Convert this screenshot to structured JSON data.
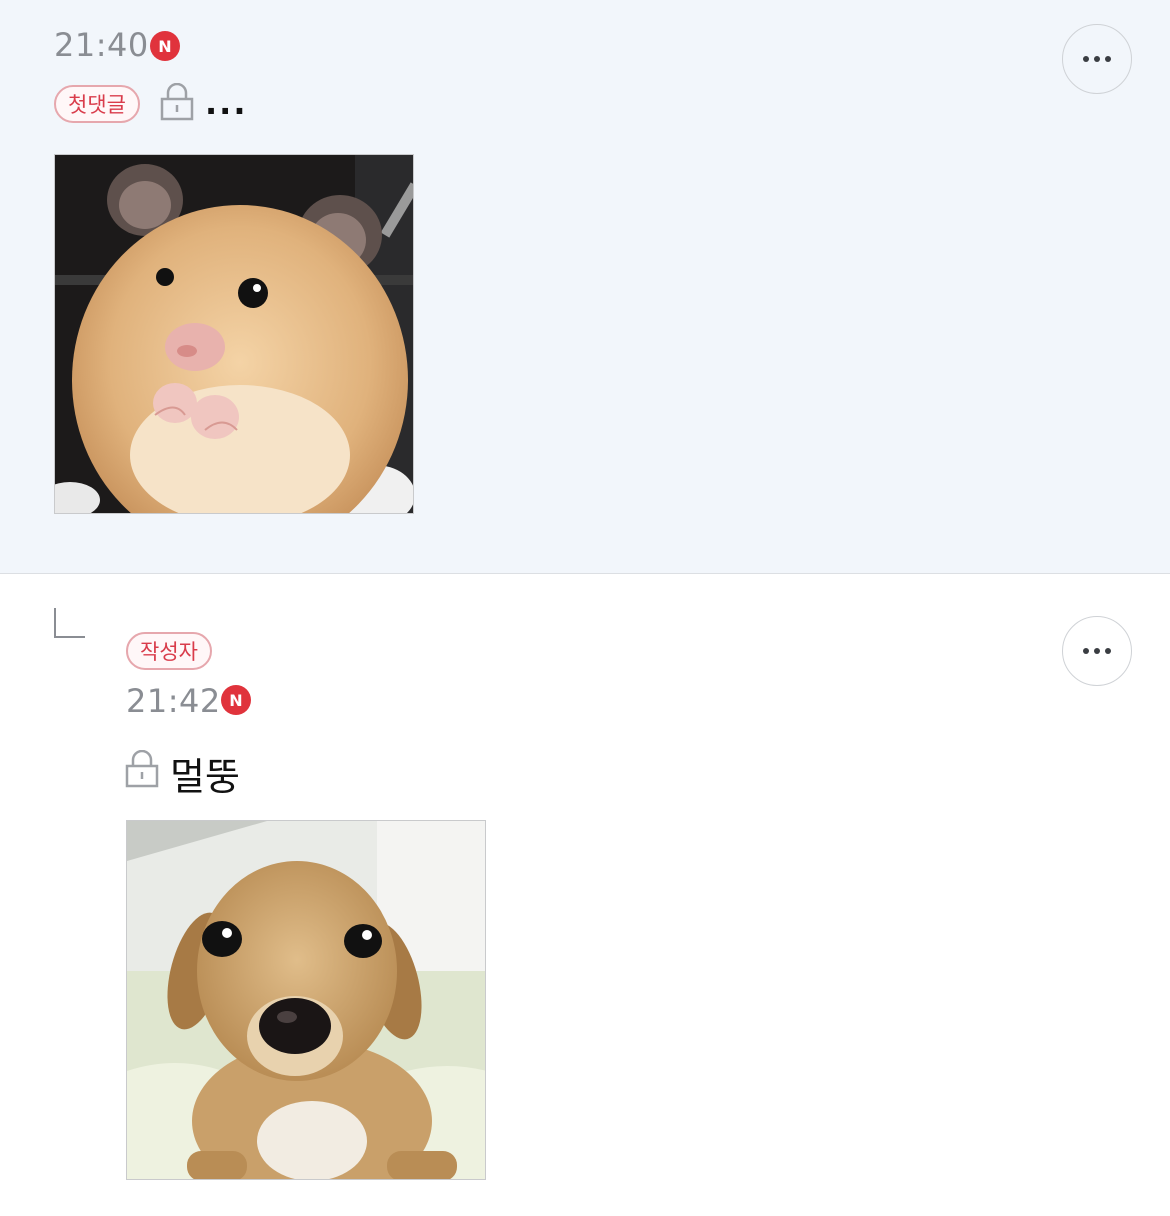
{
  "comment_1": {
    "time": "21:40",
    "new_badge": "N",
    "badge_label": "첫댓글",
    "text": "...",
    "image_subject": "hamster",
    "lock_icon": "lock-icon",
    "more_icon": "more-horizontal-icon"
  },
  "comment_2": {
    "author_badge": "작성자",
    "time": "21:42",
    "new_badge": "N",
    "text": "멀뚱",
    "image_subject": "puppy",
    "lock_icon": "lock-icon",
    "more_icon": "more-horizontal-icon",
    "reply_icon": "reply-arrow-icon"
  },
  "colors": {
    "top_background": "#f2f6fb",
    "badge_red": "#e0333c",
    "pill_text": "#d93c4b",
    "muted_text": "#8a8d93"
  }
}
